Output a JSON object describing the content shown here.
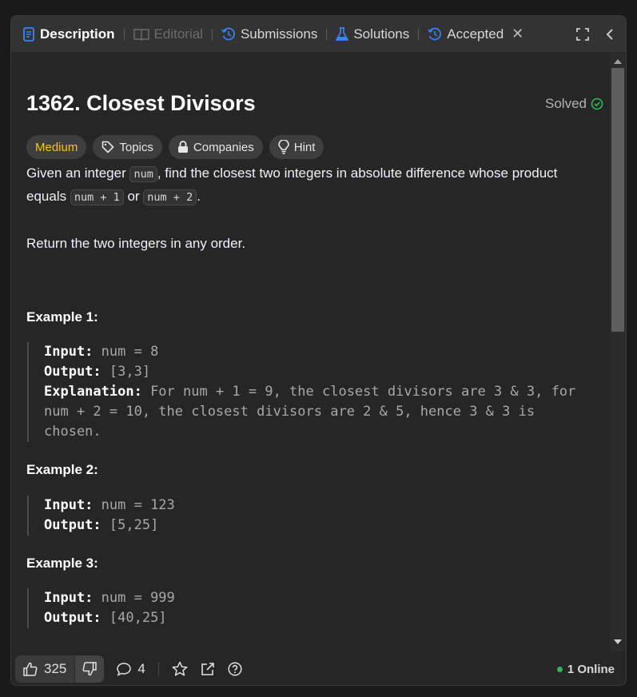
{
  "tabs": [
    {
      "label": "Description"
    },
    {
      "label": "Editorial"
    },
    {
      "label": "Submissions"
    },
    {
      "label": "Solutions"
    },
    {
      "label": "Accepted"
    }
  ],
  "problem": {
    "title": "1362. Closest Divisors",
    "status": "Solved",
    "tags": {
      "difficulty": "Medium",
      "topics": "Topics",
      "companies": "Companies",
      "hint": "Hint"
    }
  },
  "description": {
    "p1_a": "Given an integer ",
    "p1_code1": "num",
    "p1_b": ", find the closest two integers in absolute difference whose product equals ",
    "p1_code2": "num + 1",
    "p1_c": " or ",
    "p1_code3": "num + 2",
    "p1_d": ".",
    "p2": "Return the two integers in any order."
  },
  "examples": [
    {
      "title": "Example 1:",
      "input_label": "Input:",
      "input": " num = 8",
      "output_label": "Output:",
      "output": " [3,3]",
      "expl_label": "Explanation:",
      "expl": " For num + 1 = 9, the closest divisors are 3 & 3, for",
      "expl2": "num + 2 = 10, the closest divisors are 2 & 5, hence 3 & 3 is",
      "expl3": "chosen."
    },
    {
      "title": "Example 2:",
      "input_label": "Input:",
      "input": " num = 123",
      "output_label": "Output:",
      "output": " [5,25]"
    },
    {
      "title": "Example 3:",
      "input_label": "Input:",
      "input": " num = 999",
      "output_label": "Output:",
      "output": " [40,25]"
    }
  ],
  "footer": {
    "likes": "325",
    "comments": "4",
    "online": "1 Online"
  },
  "colors": {
    "accent_blue": "#3b82f6",
    "medium": "#ffc01e",
    "solved_green": "#2db55d"
  }
}
